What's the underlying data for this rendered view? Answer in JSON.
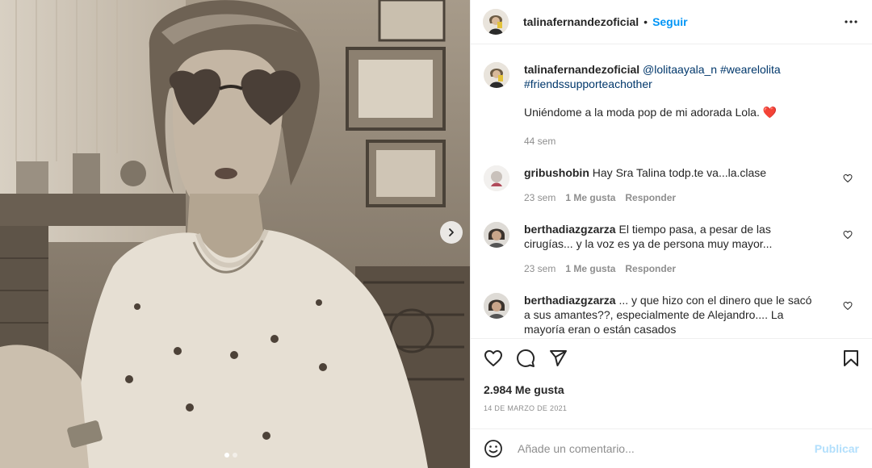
{
  "header": {
    "username": "talinafernandezoficial",
    "separator": "•",
    "follow_label": "Seguir",
    "more_icon": "more-horizontal-icon"
  },
  "caption": {
    "username": "talinafernandezoficial",
    "mention": "@lolitaayala_n",
    "hashtag1": "#wearelolita",
    "hashtag2": "#friendssupporteachother",
    "text": "Uniéndome a la moda pop de mi adorada Lola.",
    "emoji": "❤️",
    "time": "44 sem"
  },
  "comments": [
    {
      "username": "gribushobin",
      "text": "Hay Sra Talina todp.te va...la.clase",
      "time": "23 sem",
      "likes": "1 Me gusta",
      "reply": "Responder"
    },
    {
      "username": "berthadiazgzarza",
      "text": "El tiempo pasa, a pesar de las cirugías... y la voz es ya de persona muy mayor...",
      "time": "23 sem",
      "likes": "1 Me gusta",
      "reply": "Responder"
    },
    {
      "username": "berthadiazgzarza",
      "text": "... y que hizo con el dinero que le sacó a sus amantes??, especialmente de Alejandro.... La mayoría eran o están casados",
      "time": "",
      "likes": "",
      "reply": ""
    }
  ],
  "actions": {
    "like_icon": "heart-icon",
    "comment_icon": "comment-icon",
    "share_icon": "paper-plane-icon",
    "save_icon": "bookmark-icon"
  },
  "likes": "2.984 Me gusta",
  "date": "14 DE MARZO DE 2021",
  "add_comment": {
    "placeholder": "Añade un comentario...",
    "publish_label": "Publicar",
    "emoji_icon": "smiley-icon"
  },
  "carousel": {
    "current": 1,
    "total": 2
  },
  "colors": {
    "link": "#0095f6",
    "tag": "#00376b",
    "muted": "#8e8e8e",
    "publish_disabled": "#b2dffc",
    "heart_red": "#ed4956"
  }
}
